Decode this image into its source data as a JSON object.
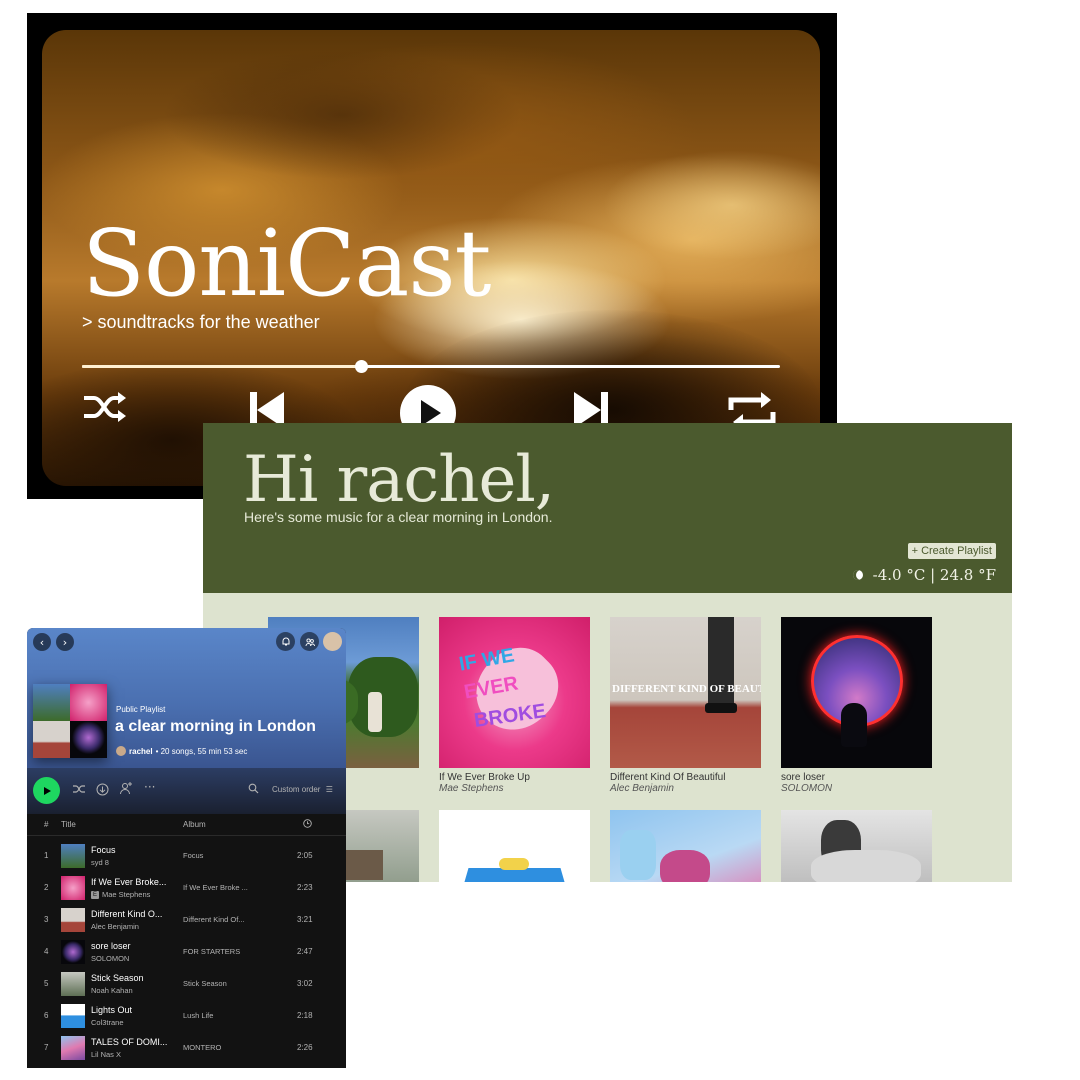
{
  "hero": {
    "title": "SoniCast",
    "tagline": "> soundtracks for the weather",
    "progress": 0.4,
    "controls": [
      "shuffle-icon",
      "previous-icon",
      "play-icon",
      "next-icon",
      "repeat-icon"
    ]
  },
  "web": {
    "greeting": "Hi rachel,",
    "subtitle": "Here's some music for a clear morning in London.",
    "create_playlist": "+ Create Playlist",
    "weather": "-4.0 °C | 24.8 °F",
    "accent": "#4b5a2e",
    "albums": [
      {
        "title": "",
        "artist": ""
      },
      {
        "title": "If We Ever Broke Up",
        "artist": "Mae Stephens"
      },
      {
        "title": "Different Kind Of Beautiful",
        "artist": "Alec Benjamin"
      },
      {
        "title": "sore loser",
        "artist": "SOLOMON"
      },
      {
        "title": "",
        "artist": ""
      },
      {
        "title": "",
        "artist": ""
      },
      {
        "title": "",
        "artist": ""
      },
      {
        "title": "",
        "artist": ""
      }
    ]
  },
  "spotify": {
    "playlist_type": "Public Playlist",
    "playlist_name": "a clear morning in London",
    "owner": "rachel",
    "meta": "• 20 songs, 55 min 53 sec",
    "sort": "Custom order",
    "columns": {
      "num": "#",
      "title": "Title",
      "album": "Album"
    },
    "play_color": "#1ed760",
    "tracks": [
      {
        "num": "1",
        "title": "Focus",
        "artist": "syd 8",
        "explicit": false,
        "album": "Focus",
        "duration": "2:05"
      },
      {
        "num": "2",
        "title": "If We Ever Broke...",
        "artist": "Mae Stephens",
        "explicit": true,
        "album": "If We Ever Broke ...",
        "duration": "2:23"
      },
      {
        "num": "3",
        "title": "Different Kind O...",
        "artist": "Alec Benjamin",
        "explicit": false,
        "album": "Different Kind Of...",
        "duration": "3:21"
      },
      {
        "num": "4",
        "title": "sore loser",
        "artist": "SOLOMON",
        "explicit": false,
        "album": "FOR STARTERS",
        "duration": "2:47"
      },
      {
        "num": "5",
        "title": "Stick Season",
        "artist": "Noah Kahan",
        "explicit": false,
        "album": "Stick Season",
        "duration": "3:02"
      },
      {
        "num": "6",
        "title": "Lights Out",
        "artist": "Col3trane",
        "explicit": false,
        "album": "Lush Life",
        "duration": "2:18"
      },
      {
        "num": "7",
        "title": "TALES OF DOMI...",
        "artist": "Lil Nas X",
        "explicit": false,
        "album": "MONTERO",
        "duration": "2:26"
      }
    ]
  }
}
